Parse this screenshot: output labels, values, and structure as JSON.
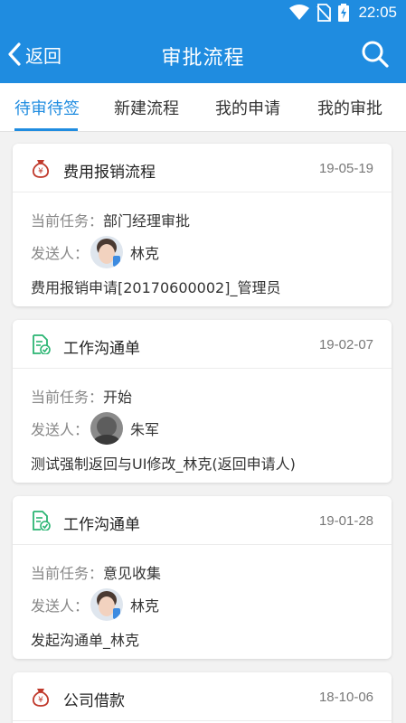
{
  "status_bar": {
    "time": "22:05",
    "icons": [
      "wifi-icon",
      "no-sim-icon",
      "battery-charging-icon"
    ]
  },
  "app_bar": {
    "back_label": "返回",
    "title": "审批流程",
    "search_icon": "search-icon"
  },
  "tabs": [
    {
      "label": "待审待签",
      "active": true
    },
    {
      "label": "新建流程",
      "active": false
    },
    {
      "label": "我的申请",
      "active": false
    },
    {
      "label": "我的审批",
      "active": false
    }
  ],
  "labels": {
    "current_task": "当前任务：",
    "sender": "发送人："
  },
  "items": [
    {
      "icon": "money-bag-icon",
      "title": "费用报销流程",
      "date": "19-05-19",
      "task": "部门经理审批",
      "sender": "林克",
      "description": "费用报销申请[20170600002]_管理员"
    },
    {
      "icon": "document-check-icon",
      "title": "工作沟通单",
      "date": "19-02-07",
      "task": "开始",
      "sender": "朱军",
      "description": "测试强制返回与UI修改_林克(返回申请人)"
    },
    {
      "icon": "document-check-icon",
      "title": "工作沟通单",
      "date": "19-01-28",
      "task": "意见收集",
      "sender": "林克",
      "description": "发起沟通单_林克"
    },
    {
      "icon": "money-bag-icon",
      "title": "公司借款",
      "date": "18-10-06"
    }
  ],
  "colors": {
    "primary": "#1f8ce0",
    "money_icon": "#c0392b",
    "doc_icon": "#2bb573"
  }
}
